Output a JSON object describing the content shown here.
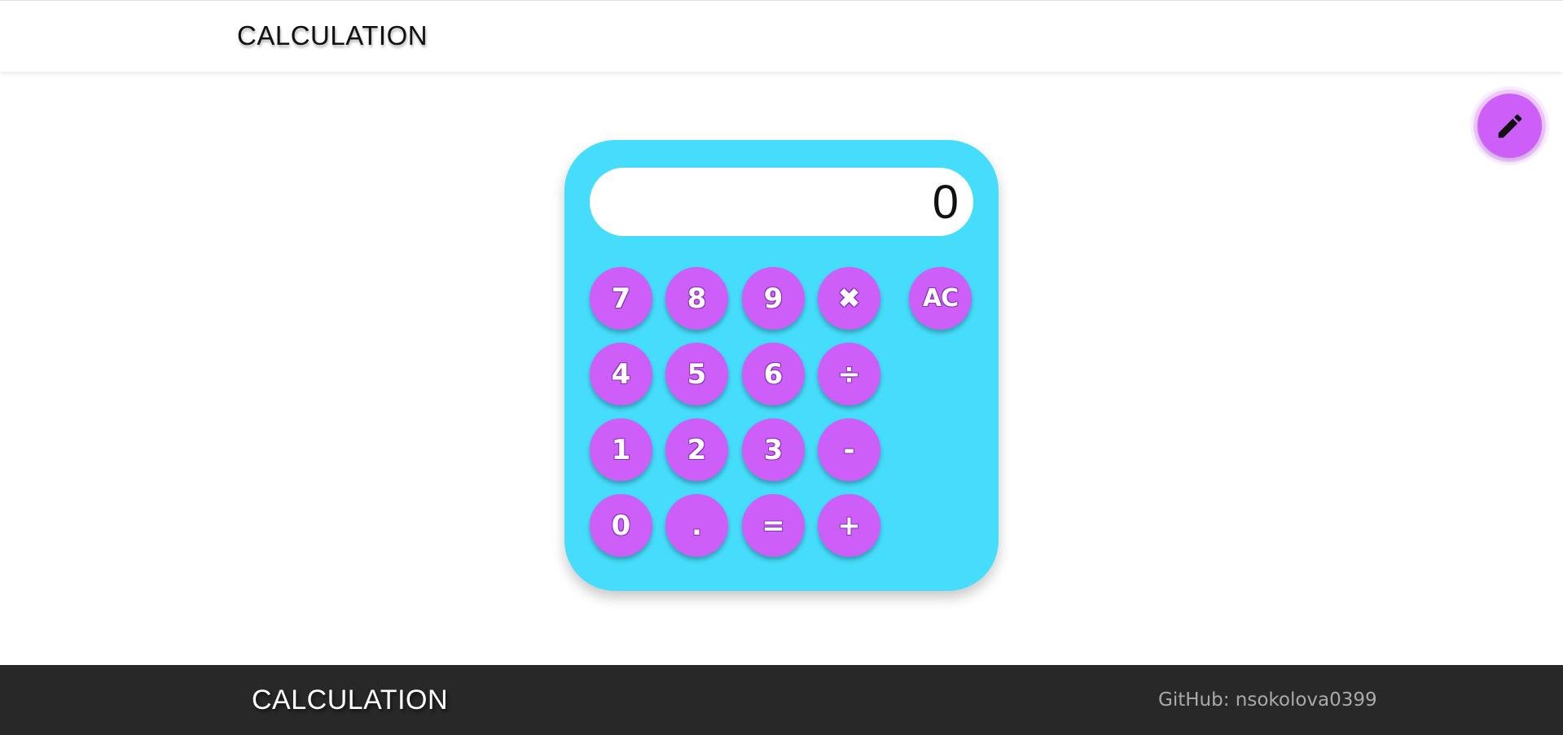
{
  "header": {
    "title": "CALCULATION"
  },
  "fab": {
    "icon": "pencil-icon"
  },
  "display": {
    "value": "0"
  },
  "keys": {
    "k7": "7",
    "k8": "8",
    "k9": "9",
    "mul": "✖",
    "ac": "AC",
    "k4": "4",
    "k5": "5",
    "k6": "6",
    "div": "÷",
    "k1": "1",
    "k2": "2",
    "k3": "3",
    "sub": "-",
    "k0": "0",
    "dot": ".",
    "eq": "=",
    "add": "+"
  },
  "footer": {
    "title": "CALCULATION",
    "github": "GitHub: nsokolova0399"
  },
  "colors": {
    "calculator_body": "#46ddfc",
    "button": "#cd5ff8",
    "footer_bg": "#282828"
  }
}
